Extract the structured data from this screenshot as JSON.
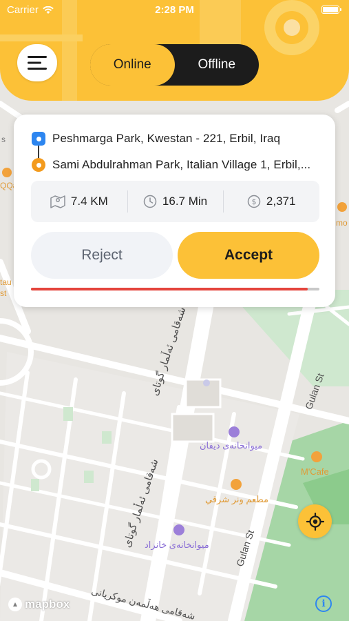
{
  "status_bar": {
    "carrier": "Carrier",
    "time": "2:28 PM"
  },
  "toggle": {
    "online_label": "Online",
    "offline_label": "Offline",
    "selected": "Online"
  },
  "trip": {
    "pickup": "Peshmarga Park, Kwestan - 221, Erbil, Iraq",
    "dropoff": "Sami Abdulrahman Park, Italian Village 1, Erbil,...",
    "distance": "7.4 KM",
    "duration": "16.7 Min",
    "fare": "2,371"
  },
  "actions": {
    "reject_label": "Reject",
    "accept_label": "Accept"
  },
  "timer_progress": 0.96,
  "map": {
    "labels": {
      "street_1": "شەقامی ئەڵمار گوتای",
      "street_2": "شەقامی ئەڵمار گوتای",
      "street_3": "شەقامی هەڵمەن موکریانی",
      "gulan_1": "Gulan St",
      "gulan_2": "Gulan St",
      "poi_1": "میوانخانەی دیفان",
      "poi_2": "مطعم ونر شرقي",
      "poi_3": "میوانخانەی خانزاد",
      "mcafe": "M'Cafe",
      "edge_1": "QQa",
      "edge_2": "tau",
      "edge_3": "st",
      "edge_4": "mo",
      "edge_5": "s"
    },
    "attribution": "mapbox"
  },
  "colors": {
    "accent": "#fcc137",
    "dark": "#1c1c1c",
    "pickup": "#2d86f0",
    "dropoff": "#f39b1e",
    "timer": "#e4443c",
    "park": "#a6d6a6"
  }
}
